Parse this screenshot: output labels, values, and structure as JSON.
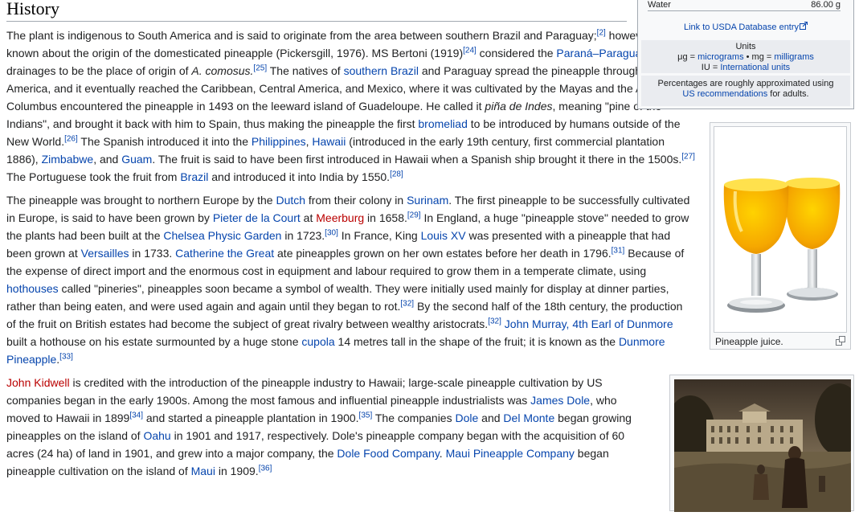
{
  "section_title": "History",
  "infobox": {
    "water_label": "Water",
    "water_value": "86.00 g",
    "usda_link": "Link to USDA Database entry",
    "units_title": "Units",
    "units_mu": "μg = ",
    "units_micrograms": "micrograms",
    "units_sep": " • mg = ",
    "units_milligrams": "milligrams",
    "units_iu": "IU = ",
    "units_international": "International units",
    "pct_text_1": "Percentages are roughly approximated using",
    "pct_link": "US recommendations",
    "pct_text_2": " for adults."
  },
  "images": {
    "juice_caption": "Pineapple juice.",
    "juice_icon": "magnify-clip-icon",
    "painting_icon": "painting-image"
  },
  "p1": {
    "t1": "The plant is indigenous to South America and is said to originate from the area between southern Brazil and Paraguay;",
    "r2": "[2]",
    "t2": " however, little is known about the origin of the domesticated pineapple (Pickersgill, 1976). MS Bertoni (1919)",
    "r24": "[24]",
    "t3": " considered the ",
    "l_parana": "Paraná–Paraguay River",
    "t4": " drainages to be the place of origin of ",
    "comosus": "A. comosus.",
    "r25": "[25]",
    "t5": " The natives of ",
    "l_sbrazil": "southern Brazil",
    "t6": " and Paraguay spread the pineapple throughout South America, and it eventually reached the Caribbean, Central America, and Mexico, where it was cultivated by the Mayas and the Aztecs. Columbus encountered the pineapple in 1493 on the leeward island of Guadeloupe. He called it ",
    "pina": "piña de Indes",
    "t7": ", meaning \"pine of the Indians\", and brought it back with him to Spain, thus making the pineapple the first ",
    "l_bromeliad": "bromeliad",
    "t8": " to be introduced by humans outside of the New World.",
    "r26": "[26]",
    "t9": " The Spanish introduced it into the ",
    "l_philippines": "Philippines",
    "t10": ", ",
    "l_hawaii": "Hawaii",
    "t11": " (introduced in the early 19th century, first commercial plantation 1886), ",
    "l_zimbabwe": "Zimbabwe",
    "t12": ", and ",
    "l_guam": "Guam",
    "t13": ". The fruit is said to have been first introduced in Hawaii when a Spanish ship brought it there in the 1500s.",
    "r27": "[27]",
    "t14": " The Portuguese took the fruit from ",
    "l_brazil": "Brazil",
    "t15": " and introduced it into India by 1550.",
    "r28": "[28]"
  },
  "p2": {
    "t1": "The pineapple was brought to northern Europe by the ",
    "l_dutch": "Dutch",
    "t2": " from their colony in ",
    "l_surinam": "Surinam",
    "t3": ". The first pineapple to be successfully cultivated in Europe, is said to have been grown by ",
    "l_pieter": "Pieter de la Court",
    "t4": " at ",
    "r_meerburg": "Meerburg",
    "t5": " in 1658.",
    "r29": "[29]",
    "t6": " In England, a huge \"pineapple stove\" needed to grow the plants had been built at the ",
    "l_chelsea": "Chelsea Physic Garden",
    "t7": " in 1723.",
    "r30": "[30]",
    "t8": " In France, King ",
    "l_louis": "Louis XV",
    "t9": " was presented with a pineapple that had been grown at ",
    "l_versailles": "Versailles",
    "t10": " in 1733. ",
    "l_catherine": "Catherine the Great",
    "t11": " ate pineapples grown on her own estates before her death in 1796.",
    "r31": "[31]",
    "t12": " Because of the expense of direct import and the enormous cost in equipment and labour required to grow them in a temperate climate, using ",
    "l_hothouses": "hothouses",
    "t13": " called \"pineries\", pineapples soon became a symbol of wealth. They were initially used mainly for display at dinner parties, rather than being eaten, and were used again and again until they began to rot.",
    "r32a": "[32]",
    "t14": " By the second half of the 18th century, the production of the fruit on British estates had become the subject of great rivalry between wealthy aristocrats.",
    "r32b": "[32]",
    "t15": " ",
    "l_murray": "John Murray, 4th Earl of Dunmore",
    "t16": " built a hothouse on his estate surmounted by a huge stone ",
    "l_cupola": "cupola",
    "t17": " 14 metres tall in the shape of the fruit; it is known as the ",
    "l_dunmore": "Dunmore Pineapple",
    "t18": ".",
    "r33": "[33]"
  },
  "p3": {
    "r_kidwell": "John Kidwell",
    "t1": " is credited with the introduction of the pineapple industry to Hawaii; large-scale pineapple cultivation by US companies began in the early 1900s. Among the most famous and influential pineapple industrialists was ",
    "l_jdole": "James Dole",
    "t2": ", who moved to Hawaii in 1899",
    "r34": "[34]",
    "t3": " and started a pineapple plantation in 1900.",
    "r35": "[35]",
    "t4": " The companies ",
    "l_dole": "Dole",
    "t5": " and ",
    "l_delmonte": "Del Monte",
    "t6": " began growing pineapples on the island of ",
    "l_oahu": "Oahu",
    "t7": " in 1901 and 1917, respectively. Dole's pineapple company began with the acquisition of 60 acres (24 ha) of land in 1901, and grew into a major company, the ",
    "l_dolefood": "Dole Food Company",
    "t8": ". ",
    "l_maui_co": "Maui Pineapple Company",
    "t9": " began pineapple cultivation on the island of ",
    "l_maui": "Maui",
    "t10": " in 1909.",
    "r36": "[36]"
  }
}
